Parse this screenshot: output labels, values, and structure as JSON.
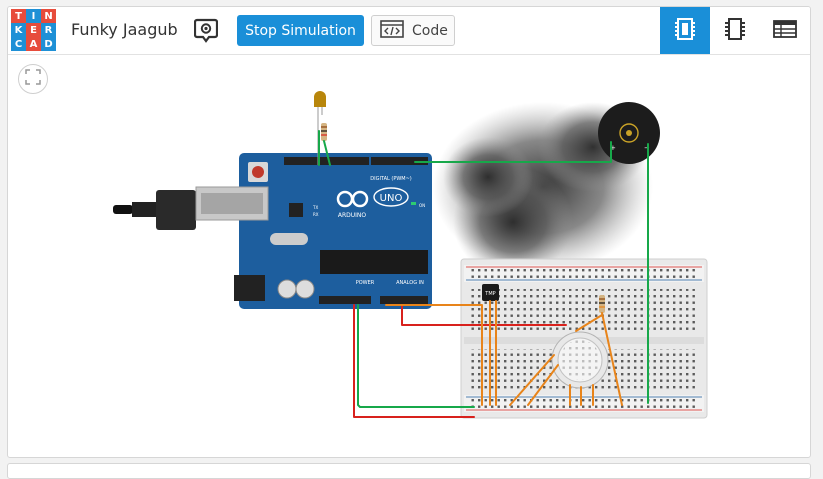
{
  "app": {
    "logo_letters": [
      "T",
      "I",
      "N",
      "K",
      "E",
      "R",
      "C",
      "A",
      "D"
    ],
    "logo_colors": [
      "#e74c3c",
      "#1e90d6",
      "#e74c3c",
      "#1e90d6",
      "#e74c3c",
      "#1e90d6",
      "#1e90d6",
      "#e74c3c",
      "#1e90d6"
    ],
    "project_title": "Funky Jaagub"
  },
  "toolbar": {
    "stop_label": "Stop Simulation",
    "code_label": "Code",
    "accent": "#1a8fd8"
  },
  "views": {
    "items": [
      {
        "name": "schematic-view",
        "icon": "breadboard-icon",
        "active": true
      },
      {
        "name": "component-list-view",
        "icon": "chip-icon",
        "active": false
      },
      {
        "name": "table-view",
        "icon": "list-table-icon",
        "active": false
      }
    ]
  },
  "circuit": {
    "board_labels": {
      "brand": "ARDUINO",
      "model": "UNO",
      "power": "POWER",
      "analog": "ANALOG IN",
      "digital": "DIGITAL (PWM~)",
      "on": "ON",
      "tx": "TX",
      "rx": "RX"
    },
    "sensor_label": "TMP",
    "buzzer_plus": "+",
    "buzzer_minus": "−",
    "board_color": "#1d5e9e",
    "wire_colors": {
      "green": "#17a84a",
      "red": "#d8211d",
      "orange": "#e8841a"
    }
  }
}
